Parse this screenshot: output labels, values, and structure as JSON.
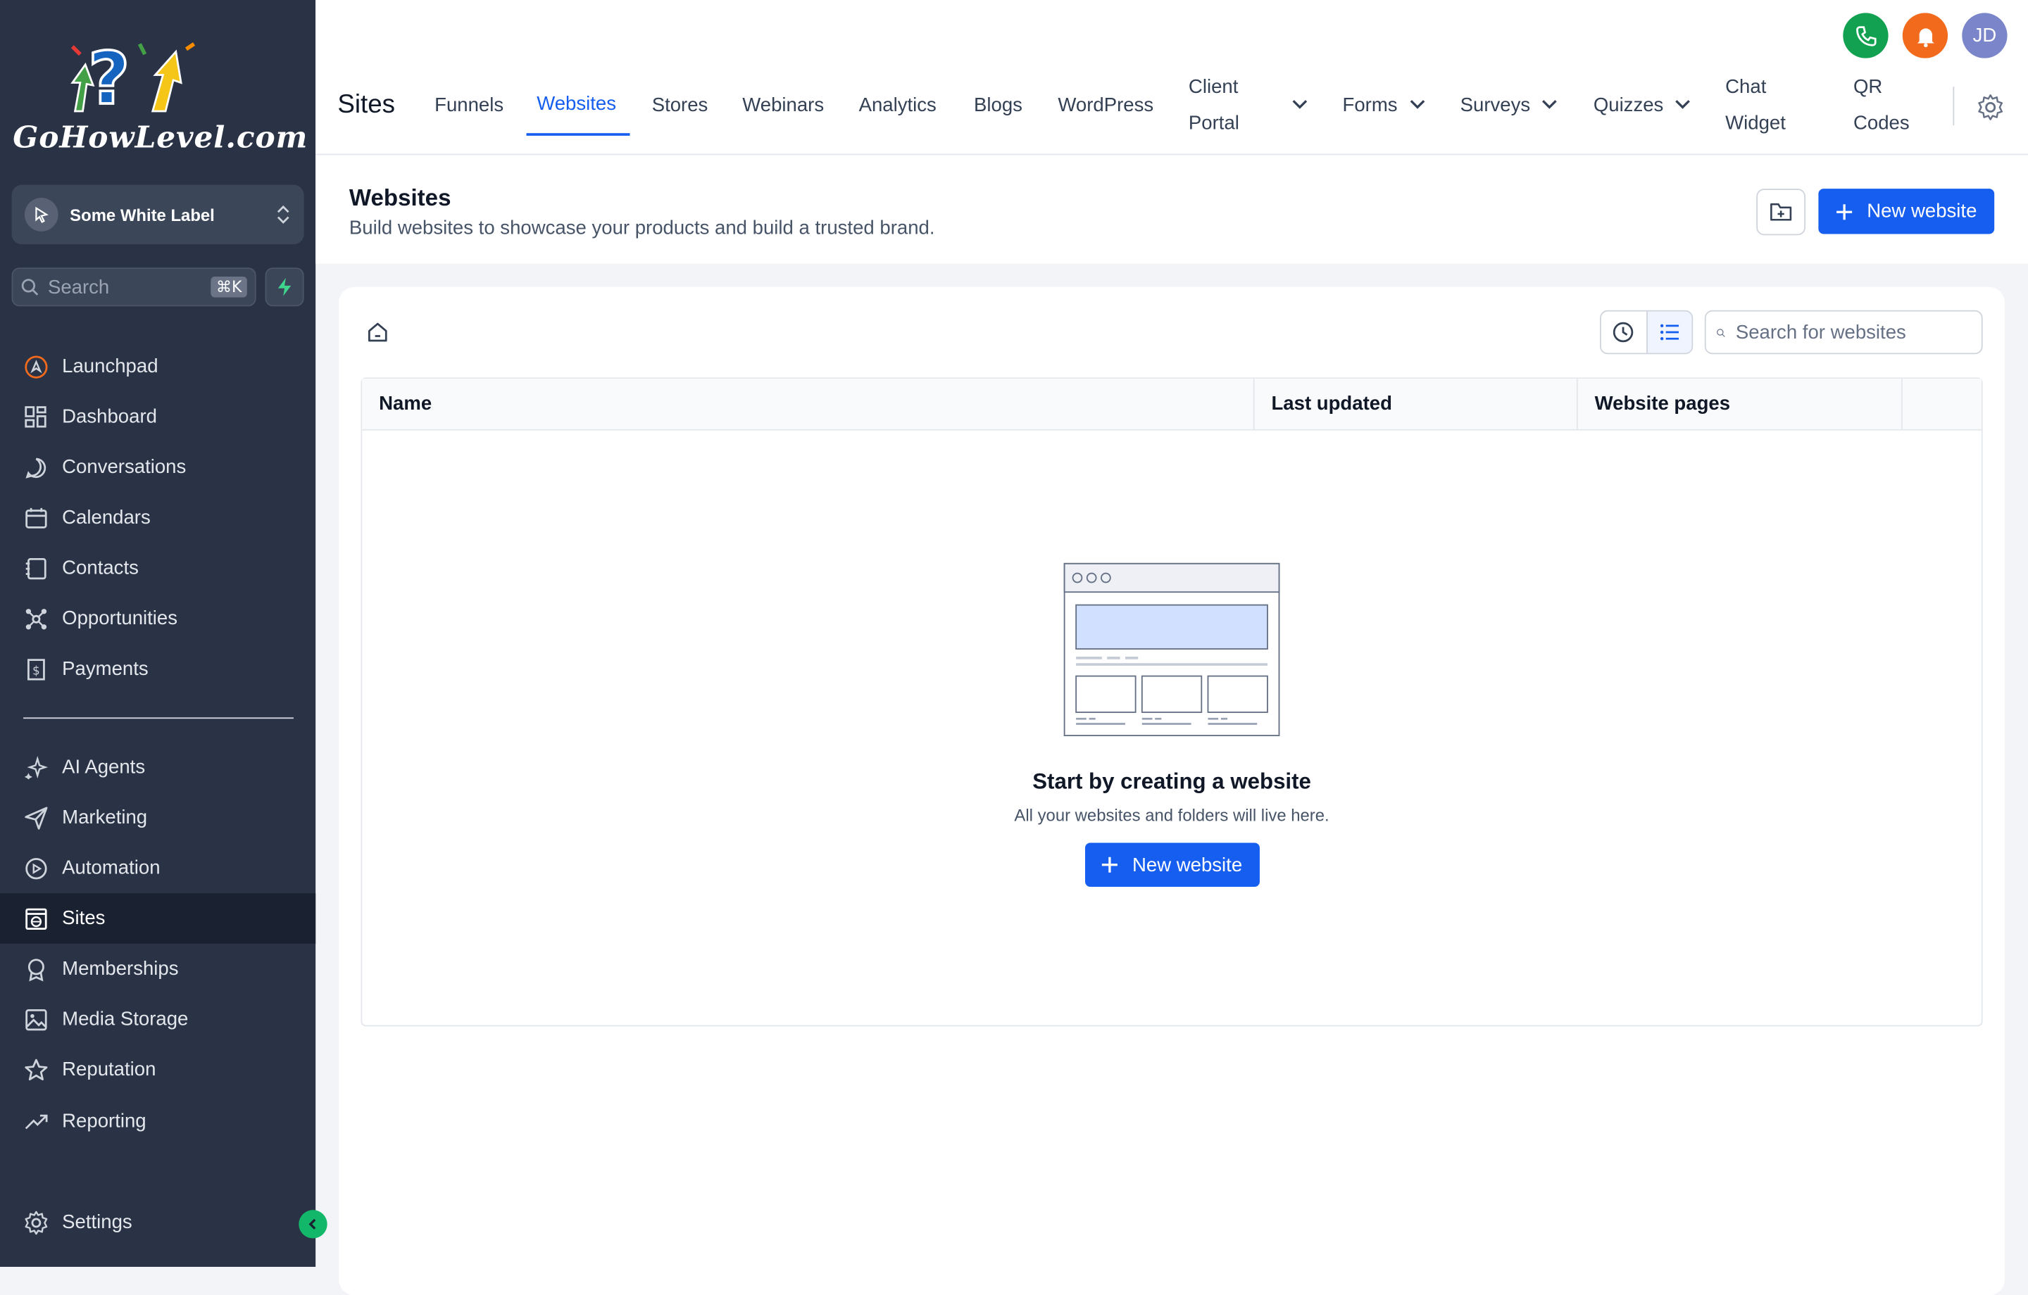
{
  "brand": {
    "logo_text": "GoHowLevel.com"
  },
  "sidebar": {
    "account_name": "Some White Label",
    "search_placeholder": "Search",
    "search_shortcut": "⌘K",
    "items": [
      {
        "label": "Launchpad",
        "icon": "rocket-icon"
      },
      {
        "label": "Dashboard",
        "icon": "grid-icon"
      },
      {
        "label": "Conversations",
        "icon": "chat-bubble-icon"
      },
      {
        "label": "Calendars",
        "icon": "calendar-icon"
      },
      {
        "label": "Contacts",
        "icon": "address-book-icon"
      },
      {
        "label": "Opportunities",
        "icon": "pipeline-icon"
      },
      {
        "label": "Payments",
        "icon": "receipt-icon"
      },
      {
        "label": "AI Agents",
        "icon": "sparkles-icon"
      },
      {
        "label": "Marketing",
        "icon": "paper-plane-icon"
      },
      {
        "label": "Automation",
        "icon": "play-circle-icon"
      },
      {
        "label": "Sites",
        "icon": "globe-window-icon"
      },
      {
        "label": "Memberships",
        "icon": "badge-icon"
      },
      {
        "label": "Media Storage",
        "icon": "image-icon"
      },
      {
        "label": "Reputation",
        "icon": "star-icon"
      },
      {
        "label": "Reporting",
        "icon": "trend-up-icon"
      }
    ],
    "active_item": "Sites",
    "settings_label": "Settings"
  },
  "topbar": {
    "section_title": "Sites",
    "tabs": [
      {
        "label": "Funnels"
      },
      {
        "label": "Websites"
      },
      {
        "label": "Stores"
      },
      {
        "label": "Webinars"
      },
      {
        "label": "Analytics"
      },
      {
        "label": "Blogs"
      },
      {
        "label": "WordPress"
      },
      {
        "label": "Client Portal"
      },
      {
        "label": "Forms"
      },
      {
        "label": "Surveys"
      },
      {
        "label": "Quizzes"
      },
      {
        "label": "Chat Widget"
      },
      {
        "label": "QR Codes"
      }
    ],
    "active_tab": "Websites",
    "avatar_initials": "JD",
    "colors": {
      "phone": "#12a150",
      "bell": "#f26a1b",
      "avatar": "#7b85c9",
      "accent": "#155eef"
    }
  },
  "page_header": {
    "title": "Websites",
    "subtitle": "Build websites to showcase your products and build a trusted brand.",
    "new_button": "New website"
  },
  "content": {
    "search_placeholder": "Search for websites",
    "columns": [
      "Name",
      "Last updated",
      "Website pages"
    ],
    "empty_title": "Start by creating a website",
    "empty_subtitle": "All your websites and folders will live here.",
    "empty_button": "New website"
  }
}
